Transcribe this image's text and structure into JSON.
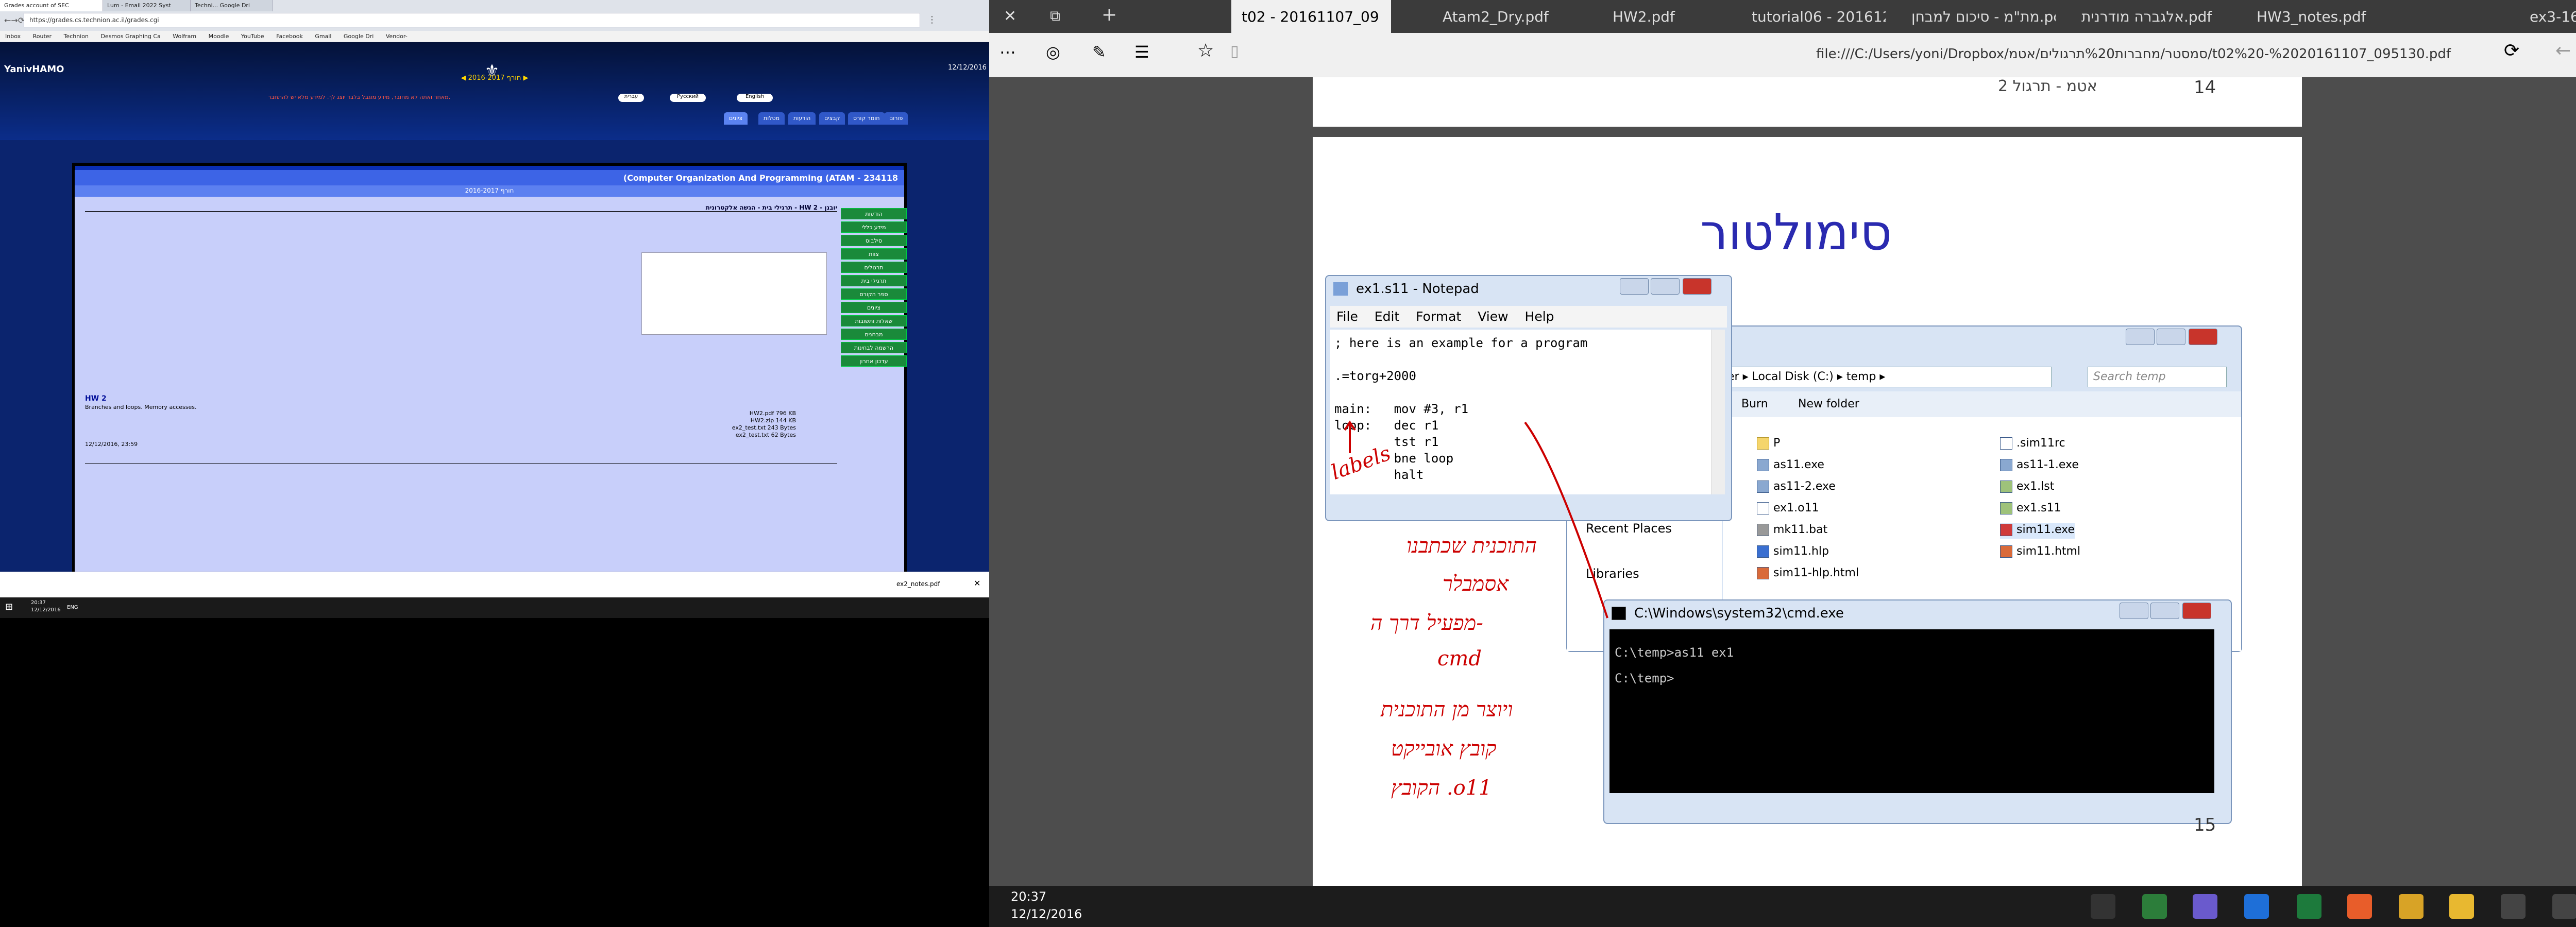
{
  "left_browser": {
    "tabs": [
      "Grades account of SEC",
      "Lum - Email 2022 Syst",
      "Techni... Google Dri"
    ],
    "address": "https://grades.cs.technion.ac.il/grades.cgi",
    "bookmarks": [
      "Inbox",
      "Router",
      "Technion",
      "Desmos Graphing Ca",
      "Wolfram",
      "Moodle",
      "YouTube",
      "Facebook",
      "Gmail",
      "Google Dri",
      "Vendor-"
    ],
    "site_user": "YanivHAMO",
    "date": "12/12/2016",
    "semester": "חורף 2016-2017",
    "lang_buttons": [
      "English",
      "Русский",
      "עברית"
    ],
    "warning": "מאחר ואתה לא מחובר, מידע מוגבל בלבד יוצג לך. למידע מלא יש להתחבר.",
    "nav_tabs": [
      "ציונים",
      "מטלות",
      "הודעות",
      "קבצים",
      "חומר קורס",
      "פורום",
      "מבחנים",
      "קישורים"
    ],
    "course_tabs": [
      "234118",
      "234118",
      "234118"
    ],
    "course_title": "(Computer Organization And Programming (ATAM - 234118",
    "course_sub": "חורף 2016-2017",
    "breadcrumb": "תרגילי בית - הגשה אלקטרונית - HW 2 - יובנן",
    "hw_title": "HW 2",
    "hw_desc": "Branches and loops. Memory accesses.",
    "files": [
      "HW2.pdf 796 KB",
      "HW2.zip 144 KB",
      "ex2_test.txt 243 Bytes",
      "ex2_test.txt 62 Bytes"
    ],
    "timestamp": "12/12/2016, 23:59",
    "menu": [
      "הודעות",
      "מידע כללי",
      "סילבוס",
      "צוות",
      "תרגולים",
      "תרגילי בית",
      "ספר הקורס",
      "ציונים",
      "שאלות ותשובות",
      "מבחנים",
      "הרשמה לבחינות",
      "עדכון אחרון"
    ],
    "download": "ex2_notes.pdf",
    "taskbar_time": "20:37",
    "taskbar_date": "12/12/2016",
    "taskbar_lang": "ENG"
  },
  "edge": {
    "tabs": [
      "t02 - 20161107_09",
      "Atam2_Dry.pdf",
      "HW2.pdf",
      "tutorial06 - 20161209_",
      "מת\"מ - סיכום למבחן.pc",
      "אלגברה מודרנית.pdf",
      "HW3_notes.pdf",
      "ex3-1617a.pdf"
    ],
    "url": "file:///C:/Users/yoni/Dropbox/סמסטר/מחברות%20תרגולים/אטמ/t02%20-%2020161107_095130.pdf",
    "page_num_top": "14",
    "page_num": "15",
    "top_header": "אטמ - תרגול 2"
  },
  "slide": {
    "title": "סימולטור",
    "notepad": {
      "title": "ex1.s11 - Notepad",
      "menu": [
        "File",
        "Edit",
        "Format",
        "View",
        "Help"
      ],
      "text": "; here is an example for a program\n\n.=torg+2000\n\nmain:   mov #3, r1\nloop:   dec r1\n        tst r1\n        bne loop\n        halt"
    },
    "explorer": {
      "path": [
        "er",
        "Local Disk (C:)",
        "temp"
      ],
      "search": "Search temp",
      "toolbar": [
        "Burn",
        "New folder"
      ],
      "sidebar": [
        "Recent Places",
        "Libraries"
      ],
      "files_col1": [
        "P",
        "as11.exe",
        "as11-2.exe",
        "ex1.o11",
        "mk11.bat",
        "sim11.hlp",
        "sim11-hlp.html"
      ],
      "files_col2": [
        ".sim11rc",
        "as11-1.exe",
        "ex1.lst",
        "ex1.s11",
        "sim11.exe",
        "sim11.html"
      ]
    },
    "cmd": {
      "title": "C:\\Windows\\system32\\cmd.exe",
      "lines": [
        "C:\\temp>as11 ex1",
        "C:\\temp>"
      ]
    },
    "annotations": [
      "labels",
      "התוכנית שכתבנו",
      "אסמבלר",
      "מפעיל דרך ה-",
      "cmd",
      "ויוצר מן התוכנית",
      "קובץ אובייקט",
      "הקובץ .o11"
    ]
  },
  "edge_taskbar": {
    "time": "20:37",
    "date": "12/12/2016"
  }
}
